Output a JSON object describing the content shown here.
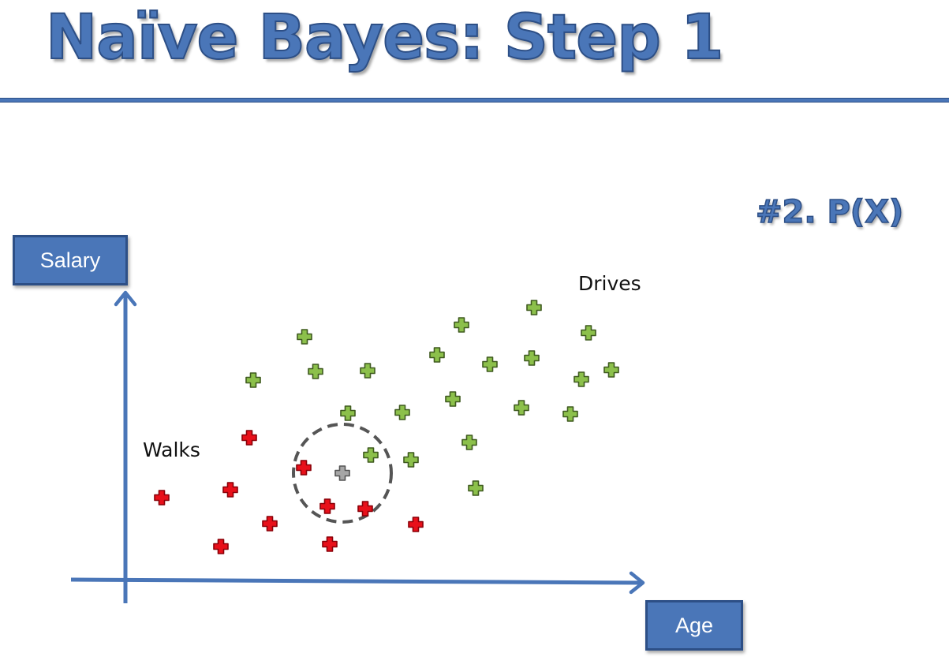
{
  "title": "Naïve Bayes: Step 1",
  "step_label": "#2. P(X)",
  "y_axis_label": "Salary",
  "x_axis_label": "Age",
  "classes": {
    "drives": {
      "label": "Drives",
      "color": "#8cc04b",
      "stroke": "#3f5a1f"
    },
    "walks": {
      "label": "Walks",
      "color": "#e8101a",
      "stroke": "#8a0008"
    },
    "new_point": {
      "color": "#a6a6a6",
      "stroke": "#555555"
    }
  },
  "colors": {
    "accent": "#4a76b8",
    "accent_dark": "#2d4f86",
    "circle": "#555555"
  },
  "chart_data": {
    "type": "scatter",
    "xlabel": "Age",
    "ylabel": "Salary",
    "series": [
      {
        "name": "Drives",
        "points": [
          [
            386,
            427
          ],
          [
            321,
            482
          ],
          [
            400,
            471
          ],
          [
            466,
            470
          ],
          [
            441,
            524
          ],
          [
            510,
            523
          ],
          [
            470,
            577
          ],
          [
            521,
            583
          ],
          [
            585,
            412
          ],
          [
            554,
            450
          ],
          [
            621,
            462
          ],
          [
            677,
            390
          ],
          [
            674,
            454
          ],
          [
            574,
            506
          ],
          [
            595,
            561
          ],
          [
            603,
            619
          ],
          [
            746,
            422
          ],
          [
            737,
            481
          ],
          [
            775,
            469
          ],
          [
            661,
            517
          ],
          [
            723,
            525
          ]
        ]
      },
      {
        "name": "Walks",
        "points": [
          [
            316,
            555
          ],
          [
            205,
            631
          ],
          [
            292,
            621
          ],
          [
            385,
            593
          ],
          [
            342,
            664
          ],
          [
            415,
            642
          ],
          [
            463,
            645
          ],
          [
            280,
            693
          ],
          [
            418,
            690
          ],
          [
            527,
            665
          ]
        ]
      },
      {
        "name": "New point",
        "points": [
          [
            434,
            600
          ]
        ]
      }
    ],
    "similarity_circle": {
      "center": [
        434,
        600
      ],
      "radius": 62
    }
  }
}
